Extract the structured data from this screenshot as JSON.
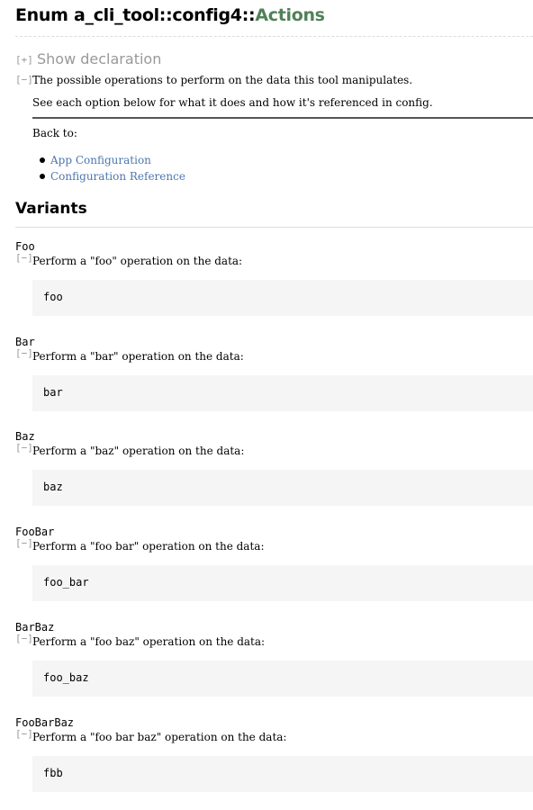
{
  "title": {
    "kind": "Enum",
    "path": "a_cli_tool::config4::",
    "name": "Actions"
  },
  "declaration": {
    "toggle": "[+]",
    "label": "Show declaration"
  },
  "doc": {
    "toggle": "[−]",
    "line1": "The possible operations to perform on the data this tool manipulates.",
    "line2": "See each option below for what it does and how it's referenced in config.",
    "back_to": "Back to:",
    "links": [
      "App Configuration",
      "Configuration Reference"
    ]
  },
  "variants_heading": "Variants",
  "variants": [
    {
      "name": "Foo",
      "toggle": "[−]",
      "description": "Perform a \"foo\" operation on the data:",
      "code": "foo"
    },
    {
      "name": "Bar",
      "toggle": "[−]",
      "description": "Perform a \"bar\" operation on the data:",
      "code": "bar"
    },
    {
      "name": "Baz",
      "toggle": "[−]",
      "description": "Perform a \"baz\" operation on the data:",
      "code": "baz"
    },
    {
      "name": "FooBar",
      "toggle": "[−]",
      "description": "Perform a \"foo bar\" operation on the data:",
      "code": "foo_bar"
    },
    {
      "name": "BarBaz",
      "toggle": "[−]",
      "description": "Perform a \"foo baz\" operation on the data:",
      "code": "foo_baz"
    },
    {
      "name": "FooBarBaz",
      "toggle": "[−]",
      "description": "Perform a \"foo bar baz\" operation on the data:",
      "code": "fbb"
    }
  ],
  "colors": {
    "type_name": "#508157",
    "link": "#4d76ae",
    "toggle": "#999999",
    "code_bg": "#f5f5f5"
  }
}
